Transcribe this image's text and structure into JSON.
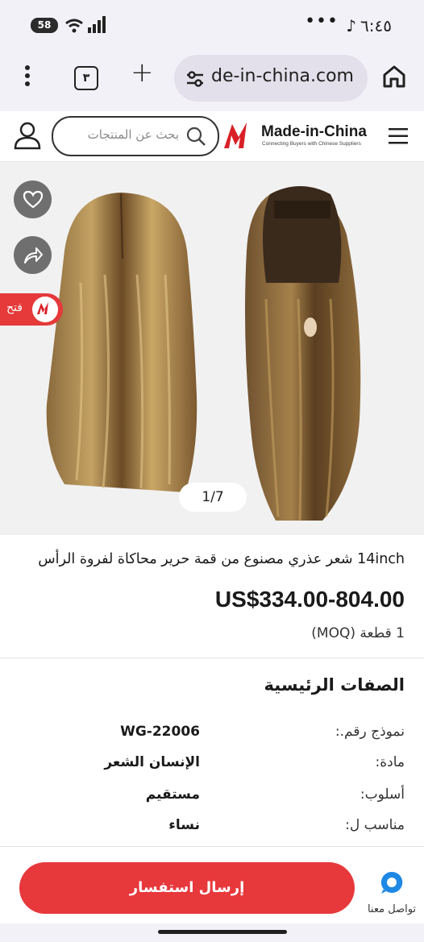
{
  "status_bar": {
    "time": "٦:٤٥",
    "battery": "58"
  },
  "browser": {
    "tabs_count": "٣",
    "url": "de-in-china.com"
  },
  "site_header": {
    "search_placeholder": "بحث عن المنتجات",
    "logo_text": "Made-in-China",
    "logo_tagline": "Connecting Buyers with Chinese Suppliers"
  },
  "gallery": {
    "open_label": "فتح",
    "counter": "1/7"
  },
  "product": {
    "title": "14inch شعر عذري مصنوع من قمة حرير محاكاة لفروة الرأس",
    "price": "US$334.00-804.00",
    "moq": "1 قطعة (MOQ)"
  },
  "attributes": {
    "heading": "الصفات الرئيسية",
    "rows": [
      {
        "label": "نموذج رقم.:",
        "value": "WG-22006"
      },
      {
        "label": "مادة:",
        "value": "الإنسان الشعر"
      },
      {
        "label": "أسلوب:",
        "value": "مستقيم"
      },
      {
        "label": "مناسب ل:",
        "value": "نساء"
      }
    ]
  },
  "bottom_bar": {
    "inquiry_label": "إرسال استفسار",
    "contact_label": "تواصل معنا"
  },
  "colors": {
    "brand_red": "#e7383c",
    "contact_blue": "#1e88e5"
  }
}
